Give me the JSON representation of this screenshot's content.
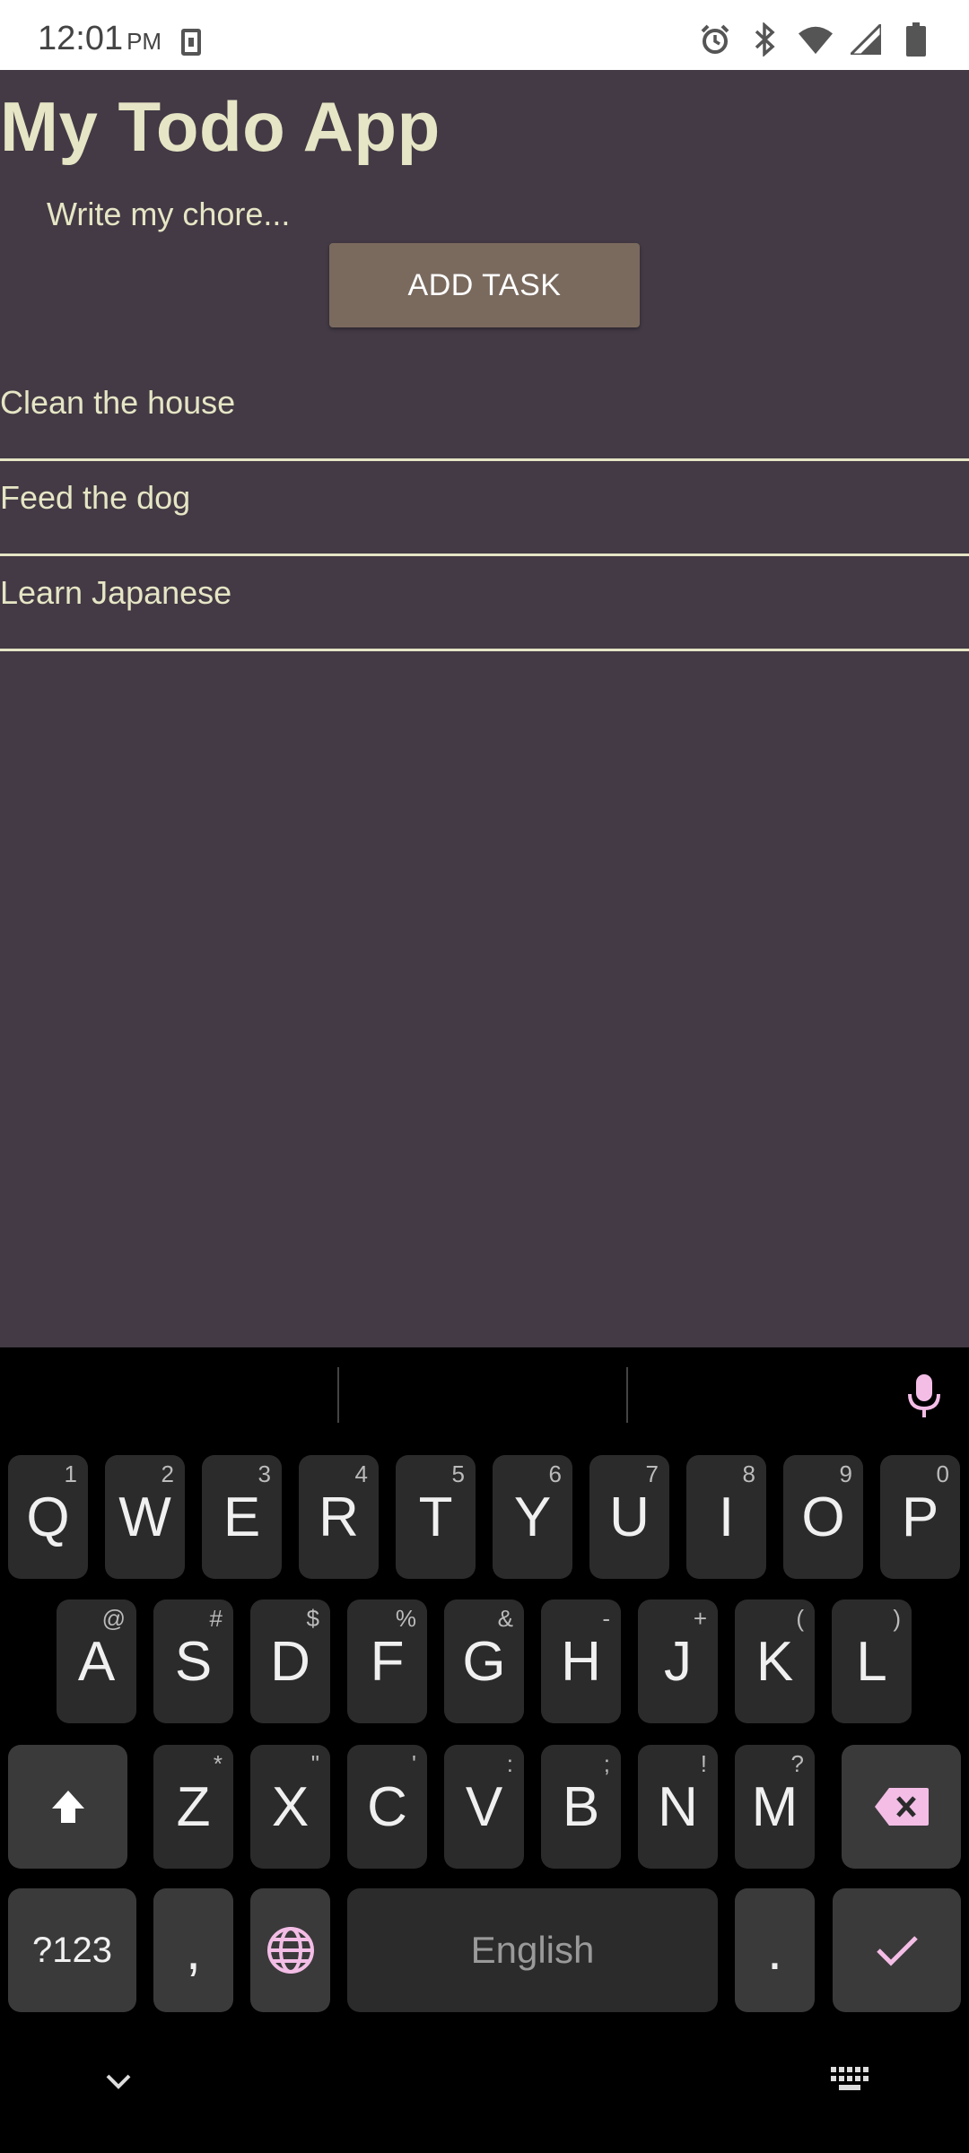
{
  "status_bar": {
    "time": "12:01",
    "ampm": "PM",
    "icons": [
      "sim-card-icon",
      "alarm-icon",
      "bluetooth-icon",
      "wifi-icon",
      "cell-signal-icon",
      "battery-icon"
    ]
  },
  "app": {
    "title": "My Todo App",
    "input_placeholder": "Write my chore...",
    "add_button_label": "ADD TASK",
    "tasks": [
      {
        "label": "Clean the house"
      },
      {
        "label": "Feed the dog"
      },
      {
        "label": "Learn Japanese"
      }
    ],
    "colors": {
      "background": "#433a45",
      "text": "#e6e5c5",
      "button": "#7a6a5e"
    }
  },
  "keyboard": {
    "row1": [
      {
        "key": "Q",
        "hint": "1"
      },
      {
        "key": "W",
        "hint": "2"
      },
      {
        "key": "E",
        "hint": "3"
      },
      {
        "key": "R",
        "hint": "4"
      },
      {
        "key": "T",
        "hint": "5"
      },
      {
        "key": "Y",
        "hint": "6"
      },
      {
        "key": "U",
        "hint": "7"
      },
      {
        "key": "I",
        "hint": "8"
      },
      {
        "key": "O",
        "hint": "9"
      },
      {
        "key": "P",
        "hint": "0"
      }
    ],
    "row2": [
      {
        "key": "A",
        "hint": "@"
      },
      {
        "key": "S",
        "hint": "#"
      },
      {
        "key": "D",
        "hint": "$"
      },
      {
        "key": "F",
        "hint": "%"
      },
      {
        "key": "G",
        "hint": "&"
      },
      {
        "key": "H",
        "hint": "-"
      },
      {
        "key": "J",
        "hint": "+"
      },
      {
        "key": "K",
        "hint": "("
      },
      {
        "key": "L",
        "hint": ")"
      }
    ],
    "row3": [
      {
        "key": "Z",
        "hint": "*"
      },
      {
        "key": "X",
        "hint": "\""
      },
      {
        "key": "C",
        "hint": "'"
      },
      {
        "key": "V",
        "hint": ":"
      },
      {
        "key": "B",
        "hint": ";"
      },
      {
        "key": "N",
        "hint": "!"
      },
      {
        "key": "M",
        "hint": "?"
      }
    ],
    "symbols_label": "?123",
    "comma_label": ",",
    "space_label": "English",
    "period_label": ".",
    "accent_color": "#f3bde6"
  }
}
